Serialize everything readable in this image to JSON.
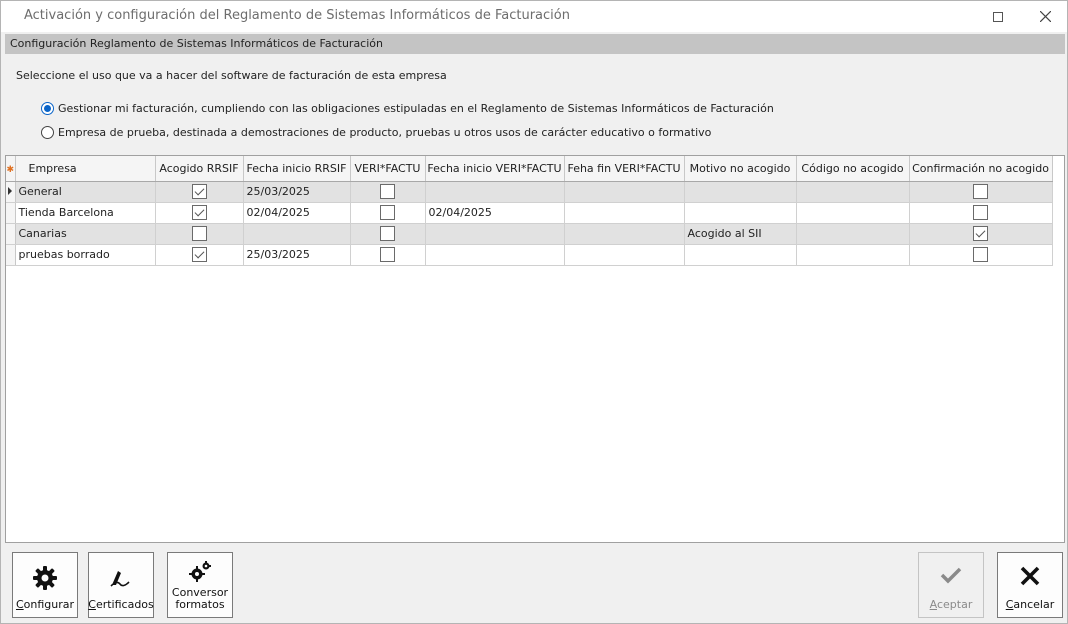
{
  "window": {
    "title": "Activación y configuración del Reglamento de Sistemas Informáticos de Facturación"
  },
  "section": {
    "header": "Configuración Reglamento de Sistemas Informáticos de Facturación",
    "prompt": "Seleccione el uso que va a hacer del software de facturación de esta empresa"
  },
  "options": [
    {
      "label": "Gestionar mi facturación, cumpliendo con las obligaciones estipuladas en el Reglamento de Sistemas Informáticos de Facturación",
      "selected": true
    },
    {
      "label": "Empresa de prueba, destinada a demostraciones de producto, pruebas u otros usos de carácter educativo o formativo",
      "selected": false
    }
  ],
  "grid": {
    "columns": [
      "Empresa",
      "Acogido RRSIF",
      "Fecha inicio RRSIF",
      "VERI*FACTU",
      "Fecha inicio VERI*FACTU",
      "Feha fin VERI*FACTU",
      "Motivo no acogido",
      "Código no acogido",
      "Confirmación no acogido"
    ],
    "rows": [
      {
        "empresa": "General",
        "acogido": true,
        "fecha_inicio_rrsif": "25/03/2025",
        "verifactu": false,
        "fecha_inicio_verifactu": "",
        "fecha_fin_verifactu": "",
        "motivo": "",
        "codigo": "",
        "confirmacion": false
      },
      {
        "empresa": "Tienda Barcelona",
        "acogido": true,
        "fecha_inicio_rrsif": "02/04/2025",
        "verifactu": false,
        "fecha_inicio_verifactu": "02/04/2025",
        "fecha_fin_verifactu": "",
        "motivo": "",
        "codigo": "",
        "confirmacion": false
      },
      {
        "empresa": "Canarias",
        "acogido": false,
        "fecha_inicio_rrsif": "",
        "verifactu": false,
        "fecha_inicio_verifactu": "",
        "fecha_fin_verifactu": "",
        "motivo": "Acogido al SII",
        "codigo": "",
        "confirmacion": true
      },
      {
        "empresa": "pruebas borrado",
        "acogido": true,
        "fecha_inicio_rrsif": "25/03/2025",
        "verifactu": false,
        "fecha_inicio_verifactu": "",
        "fecha_fin_verifactu": "",
        "motivo": "",
        "codigo": "",
        "confirmacion": false
      }
    ]
  },
  "buttons": {
    "configurar": {
      "first": "C",
      "rest": "onfigurar",
      "icon": "gear-icon"
    },
    "certificados": {
      "first": "C",
      "rest": "ertificados",
      "icon": "signature-icon"
    },
    "conversor": {
      "line1": "Conversor",
      "line2": "formatos",
      "icon": "gears-icon"
    },
    "aceptar": {
      "first": "A",
      "rest": "ceptar",
      "icon": "checkmark-icon",
      "disabled": true
    },
    "cancelar": {
      "first": "C",
      "rest": "ancelar",
      "icon": "x-icon"
    }
  },
  "colors": {
    "accent": "#0a64c8",
    "header_band": "#c4c4c4",
    "row_shade": "#e2e2e2"
  }
}
